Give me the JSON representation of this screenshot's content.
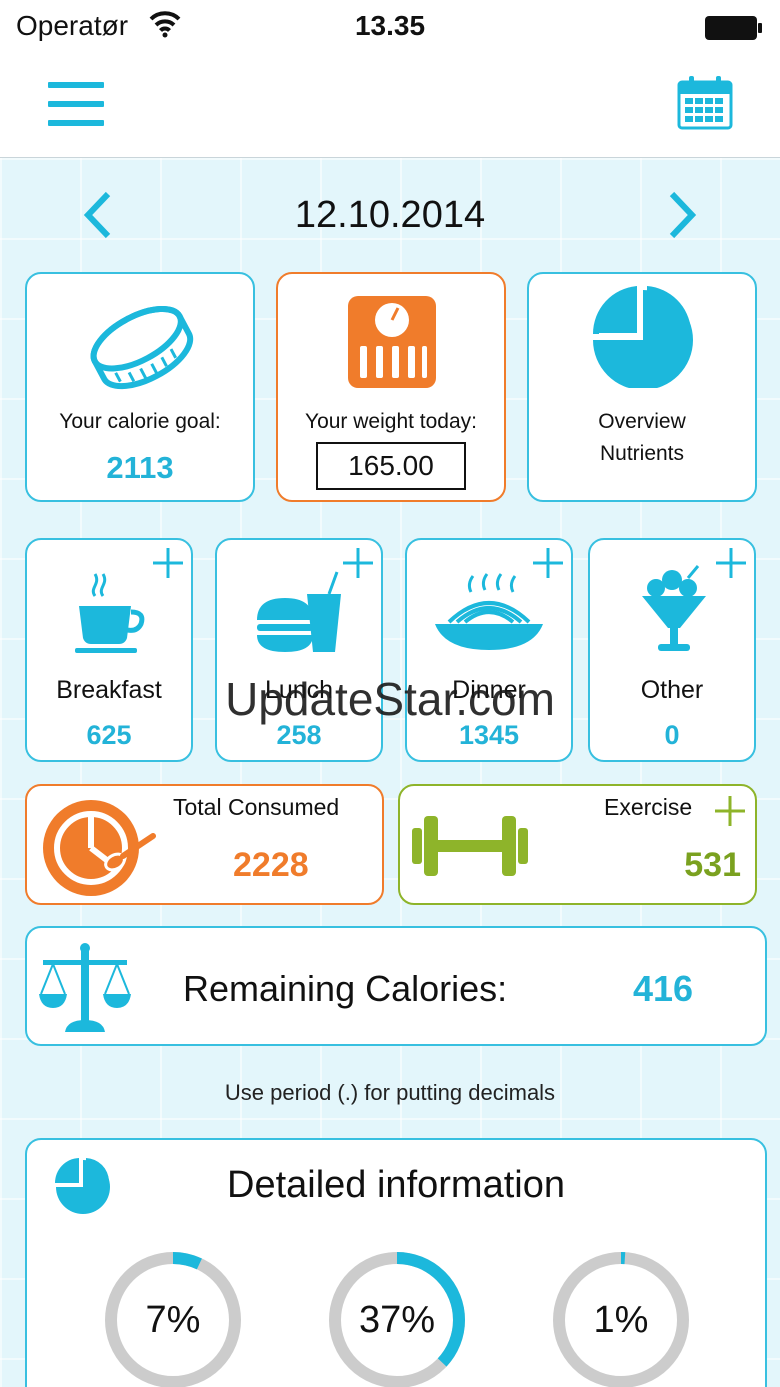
{
  "status_bar": {
    "carrier": "Operatør",
    "time": "13.35"
  },
  "nav": {
    "menu_icon": "hamburger-menu-icon",
    "calendar_icon": "calendar-icon"
  },
  "date": {
    "value": "12.10.2014"
  },
  "top_cards": {
    "calorie_goal": {
      "label": "Your calorie goal:",
      "value": "2113"
    },
    "weight": {
      "label": "Your weight today:",
      "value": "165.00"
    },
    "overview": {
      "line1": "Overview",
      "line2": "Nutrients"
    }
  },
  "meals": [
    {
      "label": "Breakfast",
      "value": "625"
    },
    {
      "label": "Lunch",
      "value": "258"
    },
    {
      "label": "Dinner",
      "value": "1345"
    },
    {
      "label": "Other",
      "value": "0"
    }
  ],
  "totals": {
    "consumed": {
      "label": "Total Consumed",
      "value": "2228"
    },
    "exercise": {
      "label": "Exercise",
      "value": "531"
    }
  },
  "remaining": {
    "label": "Remaining Calories:",
    "value": "416"
  },
  "hint": "Use period (.) for putting decimals",
  "detail": {
    "title": "Detailed information",
    "rings": [
      {
        "text": "7%",
        "fraction": 0.07
      },
      {
        "text": "37%",
        "fraction": 0.37
      },
      {
        "text": "1%",
        "fraction": 0.01
      }
    ]
  },
  "watermark": "UpdateStar.com",
  "colors": {
    "accent": "#23b3d8",
    "orange": "#f07c2b",
    "green": "#8eb42a"
  }
}
